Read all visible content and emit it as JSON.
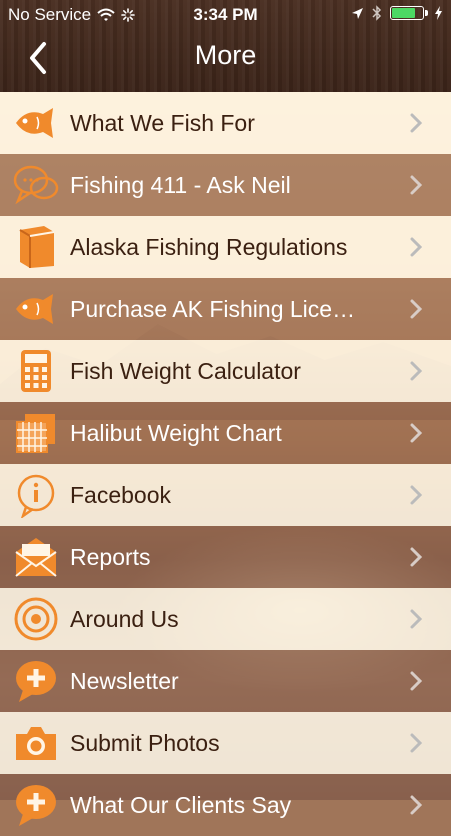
{
  "status_bar": {
    "carrier": "No Service",
    "time": "3:34 PM",
    "battery_level": 0.85
  },
  "nav": {
    "title": "More"
  },
  "menu": [
    {
      "label": "What We Fish For",
      "icon": "fish-icon"
    },
    {
      "label": "Fishing 411 - Ask Neil",
      "icon": "chat-bubbles-icon"
    },
    {
      "label": "Alaska Fishing Regulations",
      "icon": "book-icon"
    },
    {
      "label": "Purchase AK Fishing Lice…",
      "icon": "fish-icon"
    },
    {
      "label": "Fish Weight Calculator",
      "icon": "calculator-icon"
    },
    {
      "label": "Halibut Weight Chart",
      "icon": "chart-icon"
    },
    {
      "label": "Facebook",
      "icon": "info-bubble-icon"
    },
    {
      "label": "Reports",
      "icon": "envelope-icon"
    },
    {
      "label": "Around Us",
      "icon": "target-icon"
    },
    {
      "label": "Newsletter",
      "icon": "plus-bubble-icon"
    },
    {
      "label": "Submit Photos",
      "icon": "camera-icon"
    },
    {
      "label": "What Our Clients Say",
      "icon": "plus-bubble-icon"
    }
  ],
  "colors": {
    "accent_orange": "#f08a2c",
    "row_text_dark": "#3b2011",
    "battery_green": "#4cd964"
  }
}
